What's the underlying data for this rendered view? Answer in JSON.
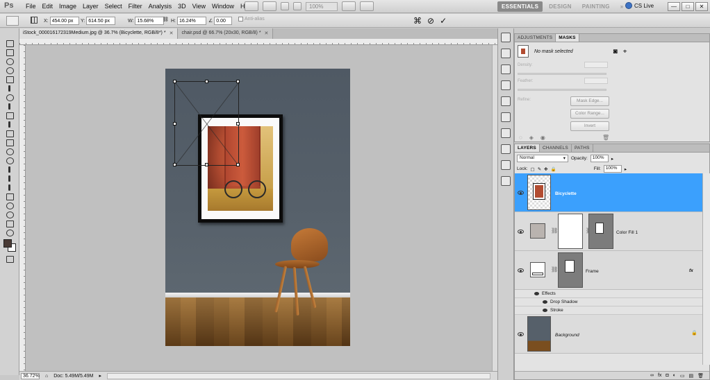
{
  "app": {
    "logo": "Ps"
  },
  "menu": [
    "File",
    "Edit",
    "Image",
    "Layer",
    "Select",
    "Filter",
    "Analysis",
    "3D",
    "View",
    "Window",
    "Help"
  ],
  "toolbar_zoom": "100%",
  "workspaces": [
    "ESSENTIALS",
    "DESIGN",
    "PAINTING",
    "»"
  ],
  "cslive": "CS Live",
  "window_buttons": [
    "—",
    "□",
    "✕"
  ],
  "options": {
    "x_label": "X:",
    "x_value": "454.00 px",
    "y_label": "Y:",
    "y_value": "614.50 px",
    "w_label": "W:",
    "w_value": "15.68%",
    "h_label": "H:",
    "h_value": "16.24%",
    "angle_value": "0.00",
    "antialias": "Anti-alias",
    "cancel": "⊘",
    "commit": "✓"
  },
  "doc_tabs": [
    {
      "label": "iStock_000016172319Medium.jpg @ 36.7% (Bicyclette, RGB/8*) *",
      "close": "✕"
    },
    {
      "label": "chair.psd @ 66.7% (20x30, RGB/8) *",
      "close": "✕"
    }
  ],
  "status": {
    "zoom": "36.72%",
    "doc": "Doc: 5.49M/5.49M"
  },
  "adjust_panel": {
    "tabs": [
      "ADJUSTMENTS",
      "MASKS"
    ],
    "mask_selected": "No mask selected",
    "density": "Density:",
    "feather": "Feather:",
    "refine": "Refine:",
    "mask_edge": "Mask Edge...",
    "color_range": "Color Range...",
    "invert": "Invert"
  },
  "layers_panel": {
    "tabs": [
      "LAYERS",
      "CHANNELS",
      "PATHS"
    ],
    "blend_mode": "Normal",
    "opacity_label": "Opacity:",
    "opacity": "100%",
    "lock_label": "Lock:",
    "fill_label": "Fill:",
    "fill": "100%",
    "layers": {
      "bicyclette": "Bicyclette",
      "color_fill": "Color Fill 1",
      "frame": "Frame",
      "frame_fx": "fx",
      "effects": "Effects",
      "drop_shadow": "Drop Shadow",
      "stroke": "Stroke",
      "background": "Background"
    },
    "footer_icons": [
      "∞",
      "fx",
      "◘",
      "◐",
      "▭",
      "▤",
      "🗑"
    ]
  },
  "colors": {
    "selection": "#3ba0fd",
    "foreground": "#4a3b36",
    "background": "#ffffff"
  },
  "icons": {
    "tools": [
      "move-icon",
      "marquee-icon",
      "lasso-icon",
      "quick-select-icon",
      "crop-icon",
      "eyedropper-icon",
      "spot-heal-icon",
      "brush-icon",
      "clone-stamp-icon",
      "history-brush-icon",
      "eraser-icon",
      "gradient-icon",
      "blur-icon",
      "dodge-icon",
      "pen-icon",
      "type-icon",
      "path-select-icon",
      "rectangle-icon",
      "3d-rotate-icon",
      "3d-orbit-icon",
      "hand-icon",
      "zoom-icon"
    ]
  }
}
